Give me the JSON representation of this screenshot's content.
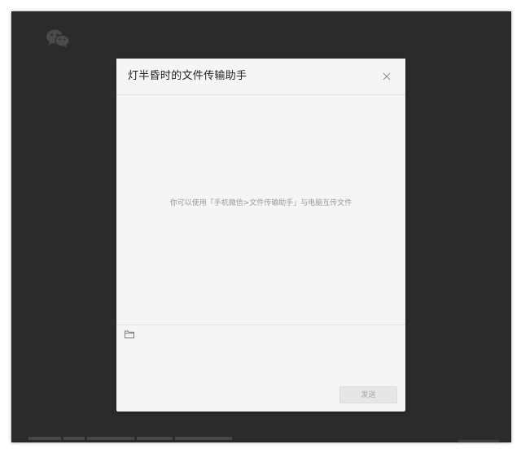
{
  "dialog": {
    "title": "灯半昏时的文件传输助手",
    "hint": "你可以使用「手机微信>文件传输助手」与电脑互传文件",
    "input_value": "",
    "send_label": "发送"
  },
  "icons": {
    "logo": "wechat-logo-icon",
    "close": "close-icon",
    "folder": "folder-icon"
  },
  "colors": {
    "backdrop": "#2b2b2b",
    "dialog_bg": "#f5f5f5",
    "hint_text": "#9a9a9a",
    "send_button_bg": "#e6e6e6",
    "send_button_text": "#a8a8a8"
  }
}
